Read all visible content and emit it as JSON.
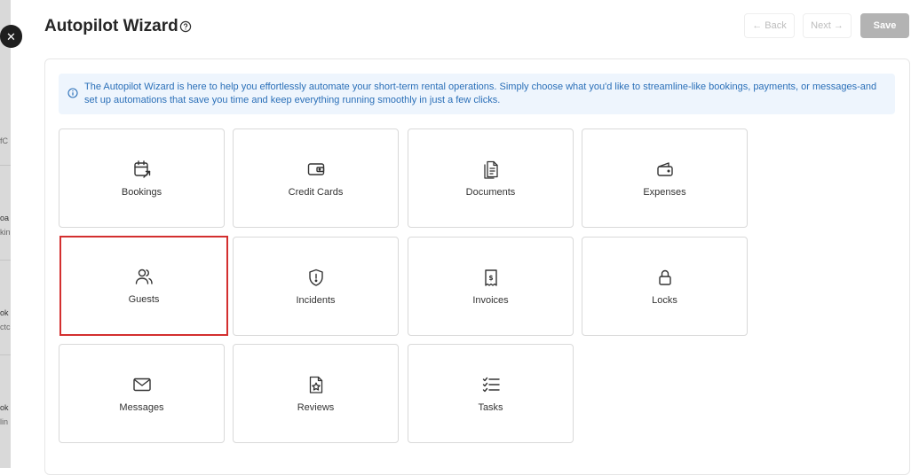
{
  "colors": {
    "accent_info": "#2a6fb8",
    "info_background": "#eef5fd",
    "selected_outline": "#d32f2f",
    "save_disabled": "#b3b3b3"
  },
  "backdrop": {
    "items": [
      {
        "text": "fC",
        "icon": ""
      },
      {
        "text": "oa",
        "icon": ""
      },
      {
        "text": "kin",
        "icon": ""
      },
      {
        "text": "ok",
        "icon": ""
      },
      {
        "text": "ctc",
        "icon": ""
      },
      {
        "text": "ok",
        "icon": ""
      },
      {
        "text": "lin",
        "icon": ""
      }
    ]
  },
  "modal": {
    "close_icon": "close-icon",
    "close_glyph": "✕",
    "title": "Autopilot Wizard",
    "help_icon": "help-circle-icon",
    "toolbar": {
      "back_label": "← Back",
      "next_label": "Next →",
      "save_label": "Save"
    },
    "info": {
      "icon": "info-icon",
      "text": "The Autopilot Wizard is here to help you effortlessly automate your short-term rental operations. Simply choose what you'd like to streamline-like bookings, payments, or messages-and set up automations that save you time and keep everything running smoothly in just a few clicks."
    },
    "categories": [
      {
        "label": "Bookings",
        "icon": "calendar-arrow-icon",
        "selected": false
      },
      {
        "label": "Credit Cards",
        "icon": "wallet-card-icon",
        "selected": false
      },
      {
        "label": "Documents",
        "icon": "documents-icon",
        "selected": false
      },
      {
        "label": "Expenses",
        "icon": "wallet-icon",
        "selected": false
      },
      {
        "label": "Guests",
        "icon": "users-icon",
        "selected": true
      },
      {
        "label": "Incidents",
        "icon": "shield-alert-icon",
        "selected": false
      },
      {
        "label": "Invoices",
        "icon": "receipt-dollar-icon",
        "selected": false
      },
      {
        "label": "Locks",
        "icon": "lock-icon",
        "selected": false
      },
      {
        "label": "Messages",
        "icon": "mail-icon",
        "selected": false
      },
      {
        "label": "Reviews",
        "icon": "file-star-icon",
        "selected": false
      },
      {
        "label": "Tasks",
        "icon": "checklist-icon",
        "selected": false
      }
    ]
  }
}
